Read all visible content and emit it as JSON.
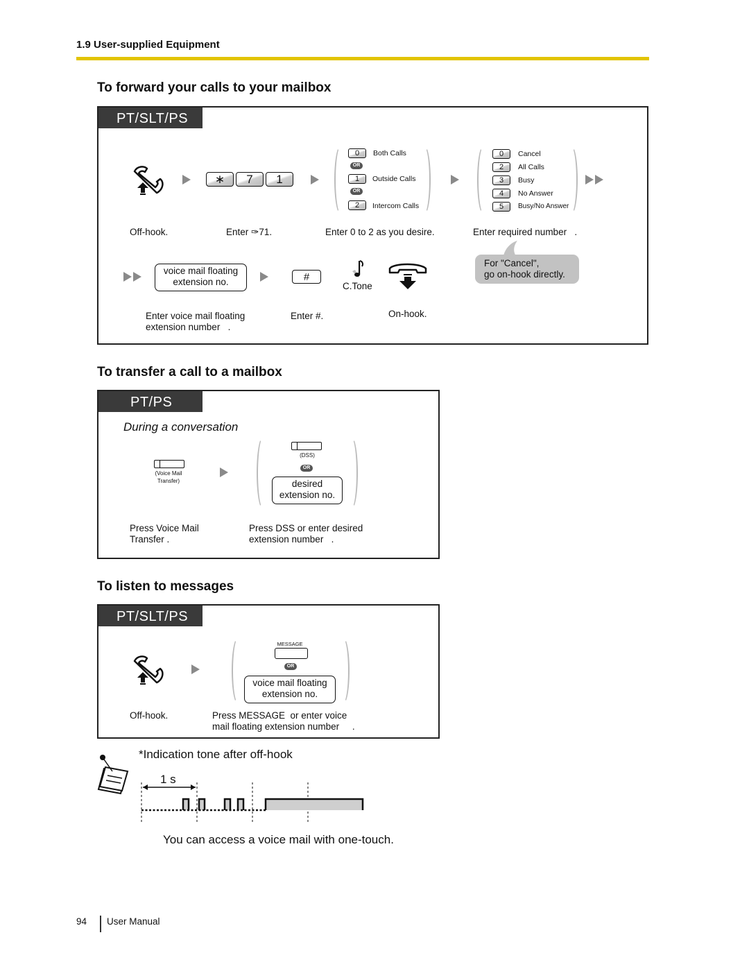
{
  "header": {
    "section": "1.9 User-supplied Equipment",
    "accent_color": "#e2c400"
  },
  "sections": [
    {
      "title": "To forward your calls to your mailbox",
      "tab": "PT/SLT/PS",
      "steps": {
        "offhook_caption": "Off-hook.",
        "keys": [
          "∗",
          "7",
          "1"
        ],
        "keys_caption": "Enter ✑71.",
        "call_type_options": [
          {
            "key": "0",
            "label": "Both Calls"
          },
          {
            "key": "1",
            "label": "Outside Calls"
          },
          {
            "key": "2",
            "label": "Intercom Calls"
          }
        ],
        "call_type_caption": "Enter 0 to 2 as you desire.",
        "forward_options": [
          {
            "key": "0",
            "label": "Cancel"
          },
          {
            "key": "2",
            "label": "All Calls"
          },
          {
            "key": "3",
            "label": "Busy"
          },
          {
            "key": "4",
            "label": "No Answer"
          },
          {
            "key": "5",
            "label": "Busy/No Answer"
          }
        ],
        "forward_caption": "Enter required number   .",
        "cancel_note": "For \"Cancel\",\ngo on-hook directly.",
        "vm_box": "voice mail floating\nextension no.",
        "vm_caption": "Enter voice mail floating\nextension number   .",
        "hash_key": "#",
        "hash_caption": "Enter #.",
        "tone_label": "C.Tone",
        "onhook_caption": "On-hook.",
        "or_label": "OR"
      }
    },
    {
      "title": "To transfer a call to a mailbox",
      "tab": "PT/PS",
      "subtitle": "During a conversation",
      "steps": {
        "vm_transfer_label": "(Voice Mail\nTransfer)",
        "vm_transfer_caption": "Press Voice Mail\nTransfer .",
        "dss_label": "(DSS)",
        "or_label": "OR",
        "ext_box": "desired\nextension no.",
        "dss_caption": "Press DSS or enter desired\nextension number   ."
      }
    },
    {
      "title": "To listen to messages",
      "tab": "PT/SLT/PS",
      "steps": {
        "offhook_caption": "Off-hook.",
        "message_label": "MESSAGE",
        "or_label": "OR",
        "vm_box": "voice mail floating\nextension no.",
        "message_caption": "Press MESSAGE  or enter voice\nmail floating extension number     ."
      }
    }
  ],
  "note": {
    "title": "*Indication tone after off-hook",
    "interval_label": "1 s",
    "description": "You can access a voice mail with one-touch."
  },
  "footer": {
    "page_number": "94",
    "label": "User Manual"
  }
}
